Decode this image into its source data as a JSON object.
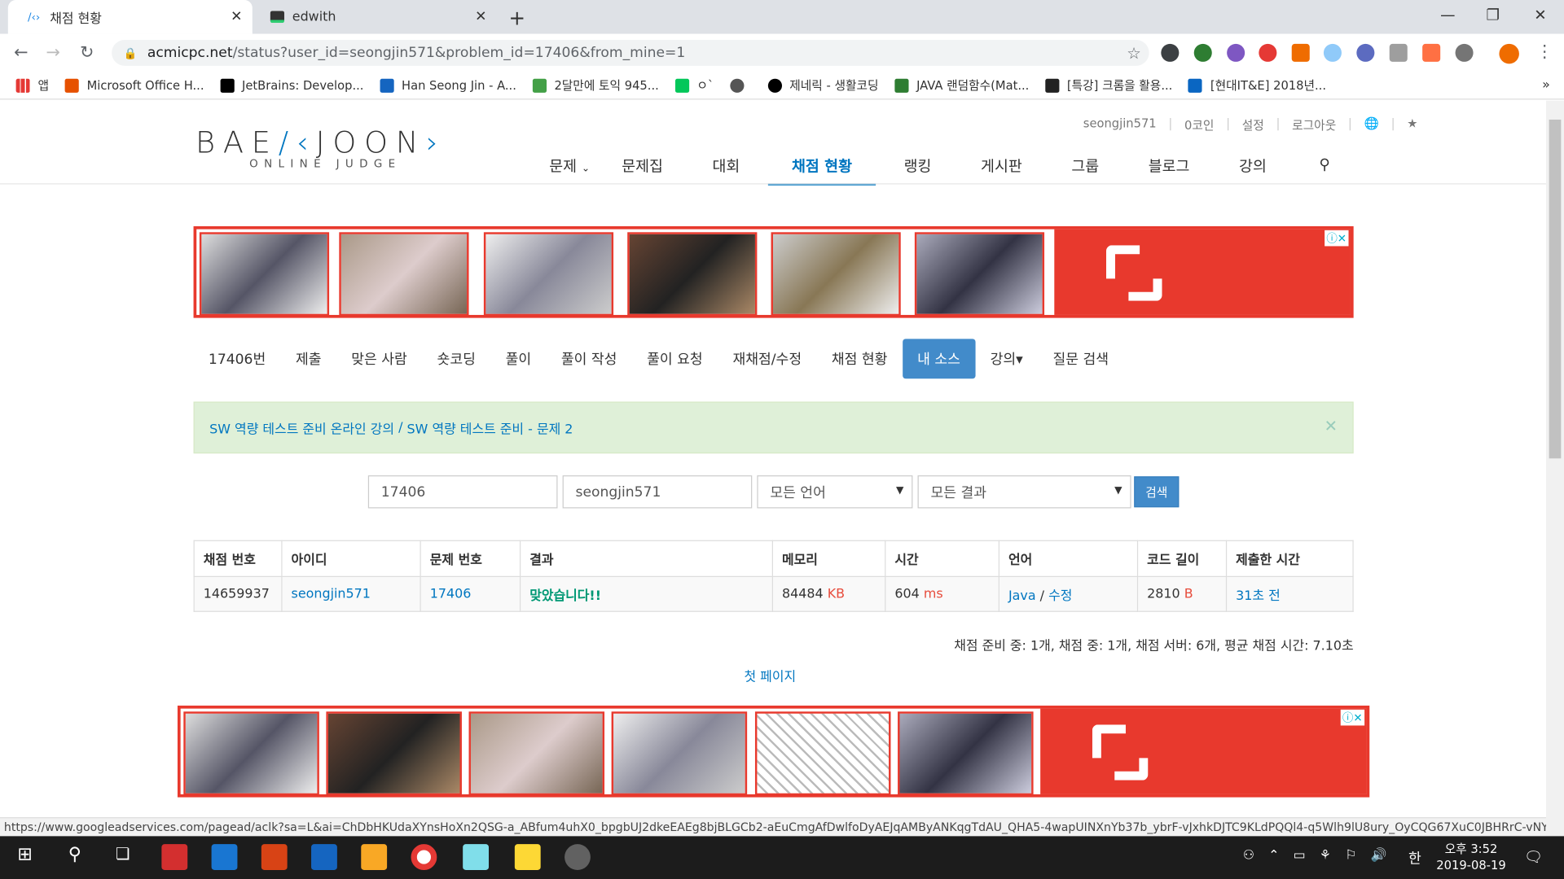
{
  "browser": {
    "tabs": [
      {
        "title": "채점 현황",
        "active": true
      },
      {
        "title": "edwith",
        "active": false
      }
    ],
    "url_host": "acmicpc.net",
    "url_path": "/status?user_id=seongjin571&problem_id=17406&from_mine=1",
    "bookmarks": [
      "앱",
      "Microsoft Office H...",
      "JetBrains: Develop...",
      "Han Seong Jin - A...",
      "2달만에 토익 945...",
      "ㅇ`",
      "제네릭 - 생활코딩",
      "JAVA 랜덤함수(Mat...",
      "[특강] 크롬을 활용...",
      "[현대IT&E] 2018년..."
    ]
  },
  "site": {
    "logo_text": "BAEKJOON",
    "logo_sub": "ONLINE JUDGE",
    "user_menu": [
      "seongjin571",
      "0코인",
      "설정",
      "로그아웃"
    ],
    "main_nav": [
      "문제",
      "문제집",
      "대회",
      "채점 현황",
      "랭킹",
      "게시판",
      "그룹",
      "블로그",
      "강의"
    ],
    "sub_nav": [
      "17406번",
      "제출",
      "맞은 사람",
      "숏코딩",
      "풀이",
      "풀이 작성",
      "풀이 요청",
      "재채점/수정",
      "채점 현황",
      "내 소스",
      "강의▾",
      "질문 검색"
    ],
    "alert": {
      "link1": "SW 역량 테스트 준비 온라인 강의",
      "sep": " / ",
      "link2": "SW 역량 테스트 준비 - 문제 2"
    },
    "search": {
      "problem_id": "17406",
      "user_id": "seongjin571",
      "language": "모든 언어",
      "result": "모든 결과",
      "button": "검색"
    },
    "table": {
      "headers": [
        "채점 번호",
        "아이디",
        "문제 번호",
        "결과",
        "메모리",
        "시간",
        "언어",
        "코드 길이",
        "제출한 시간"
      ],
      "row": {
        "submission_id": "14659937",
        "user": "seongjin571",
        "problem": "17406",
        "result": "맞았습니다!!",
        "memory": "84484",
        "memory_unit": "KB",
        "time": "604",
        "time_unit": "ms",
        "language": "Java",
        "edit": "수정",
        "code_length": "2810",
        "code_unit": "B",
        "submitted": "31초 전"
      }
    },
    "judge_status": "채점 준비 중: 1개, 채점 중: 1개, 채점 서버: 6개, 평균 채점 시간: 7.10초",
    "first_page": "첫 페이지"
  },
  "status_url": "https://www.googleadservices.com/pagead/aclk?sa=L&ai=ChDbHKUdaXYnsHoXn2QSG-a_ABfum4uhX0_bpgbUJ2dkeEAEg8bjBLGCb2-aEuCmgAfDwlfoDyAEJqAMByANKqgTdAU_QHA5-4wapUINXnYb37b_ybrF-vJxhkDJTC9KLdPQQl4-q5Wlh9lU8ury_OyCQG67XuC0JBHRrC-vNY6k...",
  "taskbar": {
    "time": "오후 3:52",
    "date": "2019-08-19",
    "ime": "한"
  },
  "colors": {
    "brand_blue": "#0076c0",
    "ad_red": "#e8392d",
    "success_green": "#009874"
  }
}
